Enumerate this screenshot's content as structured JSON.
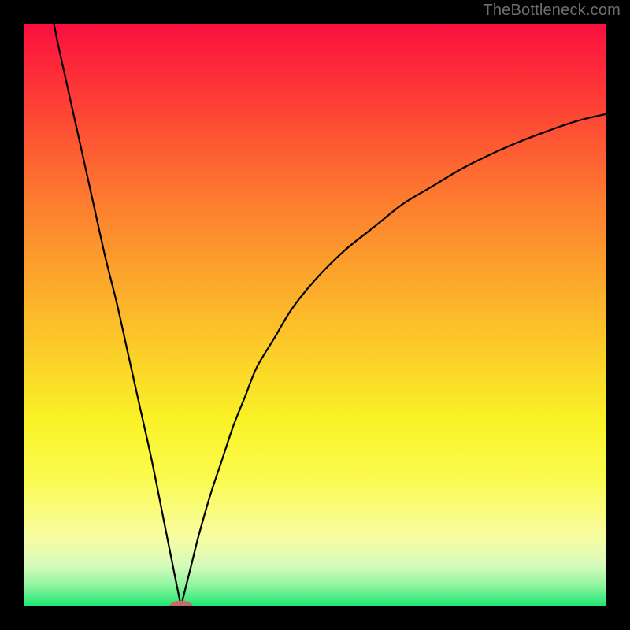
{
  "watermark": "TheBottleneck.com",
  "chart_data": {
    "type": "line",
    "title": "",
    "xlabel": "",
    "ylabel": "",
    "xlim": [
      0,
      100
    ],
    "ylim": [
      0,
      100
    ],
    "x_min_marker": 27,
    "curve_left": [
      {
        "x": 5,
        "y": 101
      },
      {
        "x": 6,
        "y": 96
      },
      {
        "x": 8,
        "y": 87
      },
      {
        "x": 10,
        "y": 78
      },
      {
        "x": 12,
        "y": 69
      },
      {
        "x": 14,
        "y": 60
      },
      {
        "x": 16,
        "y": 52
      },
      {
        "x": 18,
        "y": 43
      },
      {
        "x": 20,
        "y": 34
      },
      {
        "x": 22,
        "y": 25
      },
      {
        "x": 24,
        "y": 15
      },
      {
        "x": 25,
        "y": 10
      },
      {
        "x": 26,
        "y": 5
      },
      {
        "x": 27,
        "y": 0
      }
    ],
    "curve_right": [
      {
        "x": 27,
        "y": 0
      },
      {
        "x": 28,
        "y": 4
      },
      {
        "x": 29,
        "y": 8
      },
      {
        "x": 30,
        "y": 12
      },
      {
        "x": 32,
        "y": 19
      },
      {
        "x": 34,
        "y": 25
      },
      {
        "x": 36,
        "y": 31
      },
      {
        "x": 38,
        "y": 36
      },
      {
        "x": 40,
        "y": 41
      },
      {
        "x": 43,
        "y": 46
      },
      {
        "x": 46,
        "y": 51
      },
      {
        "x": 50,
        "y": 56
      },
      {
        "x": 55,
        "y": 61
      },
      {
        "x": 60,
        "y": 65
      },
      {
        "x": 65,
        "y": 69
      },
      {
        "x": 70,
        "y": 72
      },
      {
        "x": 75,
        "y": 75
      },
      {
        "x": 80,
        "y": 77.5
      },
      {
        "x": 85,
        "y": 79.7
      },
      {
        "x": 90,
        "y": 81.6
      },
      {
        "x": 95,
        "y": 83.3
      },
      {
        "x": 100,
        "y": 84.5
      }
    ],
    "marker": {
      "x": 27,
      "y": 0,
      "rx": 2.0,
      "ry": 1.0,
      "color": "#c76a6a"
    },
    "background_gradient": {
      "type": "vertical",
      "stops": [
        {
          "pos": 0.0,
          "color": "#fb0f3f"
        },
        {
          "pos": 0.12,
          "color": "#fd3936"
        },
        {
          "pos": 0.3,
          "color": "#fd7b2f"
        },
        {
          "pos": 0.5,
          "color": "#fcba2a"
        },
        {
          "pos": 0.68,
          "color": "#faf227"
        },
        {
          "pos": 0.78,
          "color": "#fbfb4f"
        },
        {
          "pos": 0.88,
          "color": "#f8fca1"
        },
        {
          "pos": 0.93,
          "color": "#d6fbbb"
        },
        {
          "pos": 0.965,
          "color": "#8df49d"
        },
        {
          "pos": 1.0,
          "color": "#1be772"
        }
      ]
    }
  }
}
